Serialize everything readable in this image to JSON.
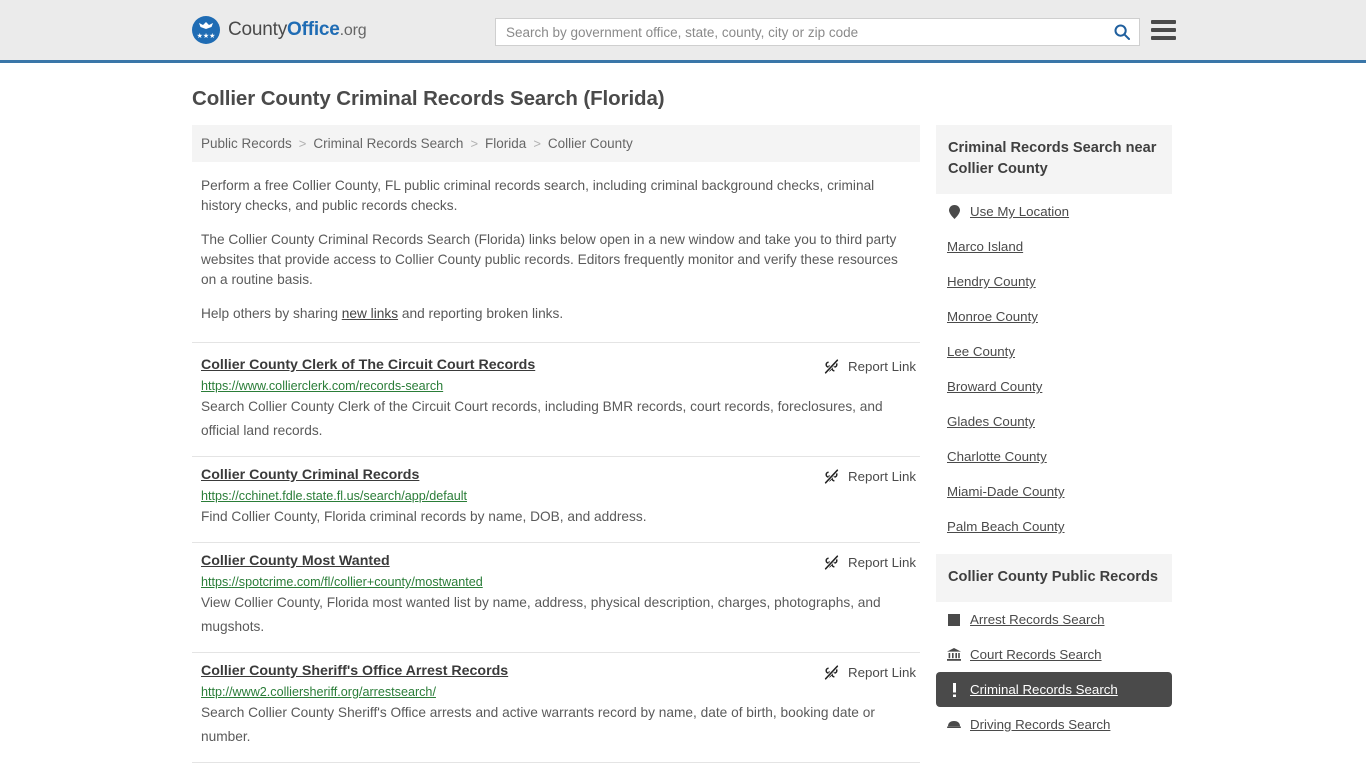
{
  "header": {
    "logo": {
      "text_before": "County",
      "text_bold": "Office",
      "text_after": ".org"
    },
    "search": {
      "placeholder": "Search by government office, state, county, city or zip code",
      "value": "",
      "search_icon": "search-icon",
      "menu_icon": "hamburger-menu-icon"
    },
    "accent_color": "#3a76a8"
  },
  "page": {
    "title": "Collier County Criminal Records Search (Florida)"
  },
  "breadcrumb": {
    "separator": ">",
    "items": [
      {
        "label": "Public Records"
      },
      {
        "label": "Criminal Records Search"
      },
      {
        "label": "Florida"
      },
      {
        "label": "Collier County"
      }
    ]
  },
  "intro": {
    "p1": "Perform a free Collier County, FL public criminal records search, including criminal background checks, criminal history checks, and public records checks.",
    "p2": "The Collier County Criminal Records Search (Florida) links below open in a new window and take you to third party websites that provide access to Collier County public records. Editors frequently monitor and verify these resources on a routine basis.",
    "p3_before": "Help others by sharing ",
    "p3_link": "new links",
    "p3_after": " and reporting broken links."
  },
  "results": {
    "report_label": "Report Link",
    "report_icon": "broken-link-icon",
    "items": [
      {
        "title": "Collier County Clerk of The Circuit Court Records",
        "url": "https://www.collierclerk.com/records-search",
        "description": "Search Collier County Clerk of the Circuit Court records, including BMR records, court records, foreclosures, and official land records."
      },
      {
        "title": "Collier County Criminal Records",
        "url": "https://cchinet.fdle.state.fl.us/search/app/default",
        "description": "Find Collier County, Florida criminal records by name, DOB, and address."
      },
      {
        "title": "Collier County Most Wanted",
        "url": "https://spotcrime.com/fl/collier+county/mostwanted",
        "description": "View Collier County, Florida most wanted list by name, address, physical description, charges, photographs, and mugshots."
      },
      {
        "title": "Collier County Sheriff's Office Arrest Records",
        "url": "http://www2.colliersheriff.org/arrestsearch/",
        "description": "Search Collier County Sheriff's Office arrests and active warrants record by name, date of birth, booking date or number."
      }
    ]
  },
  "sidebar": {
    "nearby": {
      "heading": "Criminal Records Search near Collier County",
      "items": [
        {
          "label": "Use My Location",
          "icon": "map-pin-icon"
        },
        {
          "label": "Marco Island",
          "icon": ""
        },
        {
          "label": "Hendry County",
          "icon": ""
        },
        {
          "label": "Monroe County",
          "icon": ""
        },
        {
          "label": "Lee County",
          "icon": ""
        },
        {
          "label": "Broward County",
          "icon": ""
        },
        {
          "label": "Glades County",
          "icon": ""
        },
        {
          "label": "Charlotte County",
          "icon": ""
        },
        {
          "label": "Miami-Dade County",
          "icon": ""
        },
        {
          "label": "Palm Beach County",
          "icon": ""
        }
      ]
    },
    "public_records": {
      "heading": "Collier County Public Records",
      "active_color": "#4a4a4a",
      "items": [
        {
          "label": "Arrest Records Search",
          "icon": "handcuffs-icon",
          "active": false
        },
        {
          "label": "Court Records Search",
          "icon": "courthouse-icon",
          "active": false
        },
        {
          "label": "Criminal Records Search",
          "icon": "exclamation-icon",
          "active": true
        },
        {
          "label": "Driving Records Search",
          "icon": "car-icon",
          "active": false
        }
      ]
    }
  }
}
